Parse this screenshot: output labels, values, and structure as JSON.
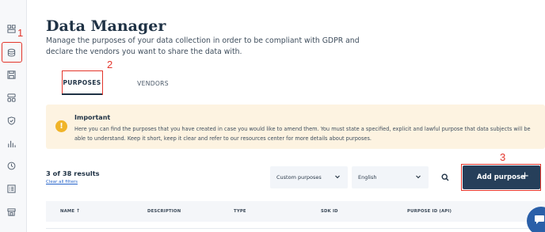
{
  "app": {
    "title": "Data Manager",
    "subtitle": "Manage the purposes of your data collection in order to be compliant with GDPR and declare the vendors you want to share the data with."
  },
  "sidebar": {
    "items": [
      {
        "icon": "dashboard-icon"
      },
      {
        "icon": "database-icon",
        "active": true
      },
      {
        "icon": "save-icon"
      },
      {
        "icon": "layout-icon"
      },
      {
        "icon": "shield-check-icon"
      },
      {
        "icon": "bar-chart-icon"
      },
      {
        "icon": "history-icon"
      },
      {
        "icon": "list-icon"
      },
      {
        "icon": "store-icon"
      }
    ]
  },
  "annotations": {
    "step1": "1",
    "step2": "2",
    "step3": "3",
    "color": "#e3352b"
  },
  "tabs": {
    "purposes": "PURPOSES",
    "vendors": "VENDORS"
  },
  "alert": {
    "icon": "exclamation",
    "title": "Important",
    "body": "Here you can find the purposes that you have created in case you would like to amend them. You must state a specified, explicit and lawful purpose that data subjects will be able to understand. Keep it short, keep it clear and refer to our resources center for more details about purposes."
  },
  "results": {
    "count": "3 of 38 results",
    "clear": "Clear all filters"
  },
  "filters": {
    "purpose_type": "Custom purposes",
    "language": "English"
  },
  "add_button": {
    "label": "Add purpose",
    "plus": "+"
  },
  "table": {
    "columns": [
      "NAME",
      "DESCRIPTION",
      "TYPE",
      "SDK ID",
      "PURPOSE ID (API)"
    ],
    "sort_indicator": "↑"
  },
  "colors": {
    "accent": "#263f5a",
    "alert_bg": "#fdf3e1",
    "alert_icon": "#f0b429",
    "link": "#2563c9"
  }
}
